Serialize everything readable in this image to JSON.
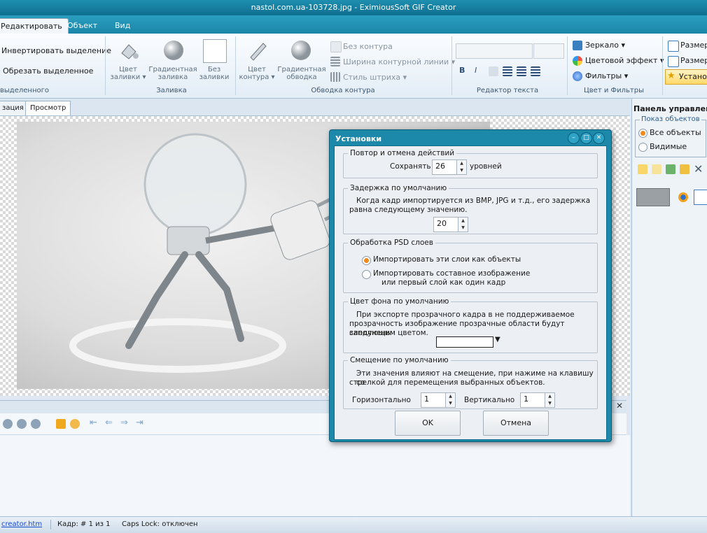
{
  "window": {
    "title": "nastol.com.ua-103728.jpg - EximiousSoft GIF Creator"
  },
  "ribbon_tabs": [
    "Редактировать",
    "Объект",
    "Вид"
  ],
  "ribbon": {
    "selection": {
      "invert": "Инвертировать выделение",
      "crop": "Обрезать выделенное",
      "group_label": "выделенного"
    },
    "fill": {
      "color_l1": "Цвет",
      "color_l2": "заливки ▾",
      "gradient_l1": "Градиентная",
      "gradient_l2": "заливка",
      "none_l1": "Без",
      "none_l2": "заливки",
      "group_label": "Заливка"
    },
    "outline": {
      "color_l1": "Цвет",
      "color_l2": "контура ▾",
      "gradient_l1": "Градиентная",
      "gradient_l2": "обводка",
      "no_outline": "Без контура",
      "width": "Ширина контурной линии ▾",
      "style": "Стиль штриха ▾",
      "group_label": "Обводка контура"
    },
    "text_editor": {
      "group_label": "Редактор текста",
      "bold": "B",
      "italic": "I"
    },
    "color": {
      "mirror": "Зеркало ▾",
      "effect": "Цветовой эффект ▾",
      "filters": "Фильтры ▾",
      "group_label": "Цвет и Фильтры"
    },
    "size": {
      "size1": "Размер",
      "size2": "Размер",
      "setup": "Установ"
    }
  },
  "doc_tabs": [
    "зация",
    "Просмотр"
  ],
  "right_panel": {
    "title": "Панель управлени",
    "show_objects": "Показ объектов",
    "all_objects": "Все объекты",
    "visible": "Видимые"
  },
  "status": {
    "link": "creator.htm",
    "frame": "Кадр: # 1 из 1",
    "caps": "Caps Lock: отключен"
  },
  "dialog": {
    "title": "Установки",
    "undo": {
      "legend": "Повтор и отмена действий",
      "keep": "Сохранять",
      "value": "26",
      "levels": "уровней"
    },
    "delay": {
      "legend": "Задержка по умолчанию",
      "text_l1": "Когда кадр импортируется из BMP, JPG и т.д., его задержка",
      "text_l2": "равна следующему значению.",
      "value": "20"
    },
    "psd": {
      "legend": "Обработка PSD слоев",
      "opt1": "Импортировать эти слои как объекты",
      "opt2_l1": "Импортировать составное изображение",
      "opt2_l2": "или первый слой как один кадр"
    },
    "bg": {
      "legend": "Цвет фона по умолчанию",
      "text_l1": "При экспорте прозрачного кадра в не поддерживаемое",
      "text_l2": "прозрачность изображение прозрачные области будут заполнены",
      "text_l3": "следующим цветом.",
      "color": "#ffffff"
    },
    "offset": {
      "legend": "Смещение по умолчанию",
      "text_l1": "Эти значения влияют на смещение, при нажиме на клавишу со",
      "text_l2": "стрелкой для перемещения выбранных объектов.",
      "h_label": "Горизонтально",
      "h_value": "1",
      "v_label": "Вертикально",
      "v_value": "1"
    },
    "ok": "OK",
    "cancel": "Отмена"
  }
}
